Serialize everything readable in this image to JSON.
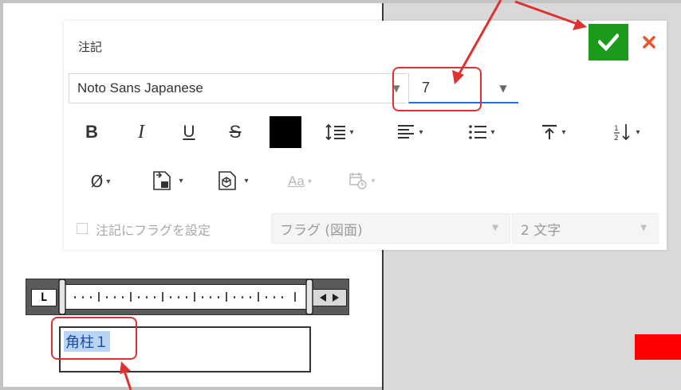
{
  "dialog": {
    "title": "注記",
    "ok_icon": "checkmark-icon",
    "cancel_icon": "close-icon"
  },
  "font": {
    "family_value": "Noto Sans Japanese",
    "size_value": "7"
  },
  "toolbar": {
    "bold": "B",
    "italic": "I",
    "underline": "U",
    "strikethrough": "S",
    "text_color": "#000000",
    "symbol": "Ø",
    "case": "Aa"
  },
  "flag": {
    "checkbox_label": "注記にフラグを設定",
    "type_value": "フラグ (図面)",
    "chars_value": "2 文字"
  },
  "ruler": {
    "tab_stop": "L"
  },
  "note_text": {
    "selected_text": "角柱１"
  },
  "colors": {
    "accent_blue": "#2b6cd4",
    "ok_green": "#1a9b1a",
    "annotation_red": "#e03030",
    "selection_blue": "#b9d4f3"
  }
}
